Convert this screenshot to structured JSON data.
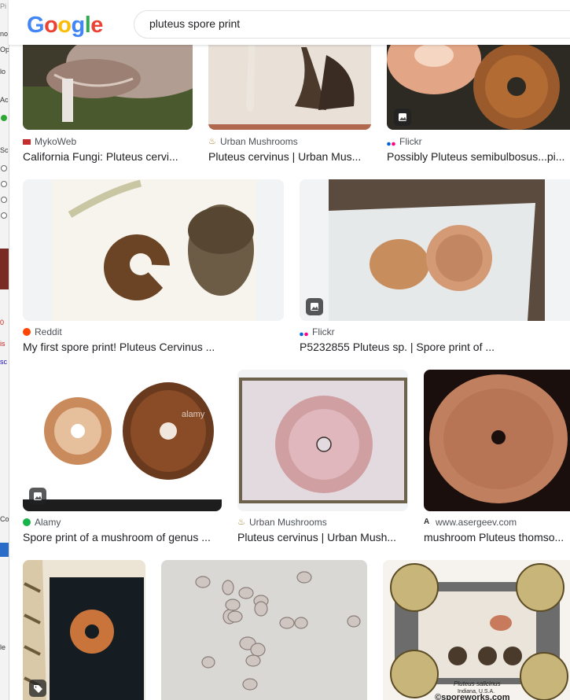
{
  "search": {
    "query": "pluteus spore print"
  },
  "logo": {
    "letters": [
      "G",
      "o",
      "o",
      "g",
      "l",
      "e"
    ],
    "colors": [
      "#4285F4",
      "#EA4335",
      "#FBBC05",
      "#4285F4",
      "#34A853",
      "#EA4335"
    ]
  },
  "left_strip": [
    "Pi",
    "no",
    "Op",
    "lo",
    "Ac",
    "Sc",
    "0",
    "is",
    "sc",
    "Co",
    "le"
  ],
  "results": [
    {
      "source": "MykoWeb",
      "title": "California Fungi: Pluteus cervi...",
      "icon": "mykoweb-favicon-icon",
      "badge": ""
    },
    {
      "source": "Urban Mushrooms",
      "title": "Pluteus cervinus | Urban Mus...",
      "icon": "urban-mushrooms-favicon-icon",
      "badge": ""
    },
    {
      "source": "Flickr",
      "title": "Possibly Pluteus semibulbosus...pi...",
      "icon": "flickr-favicon-icon",
      "badge": "image-icon"
    },
    {
      "source": "Reddit",
      "title": "My first spore print! Pluteus Cervinus ...",
      "icon": "reddit-favicon-icon",
      "badge": ""
    },
    {
      "source": "Flickr",
      "title": "P5232855 Pluteus sp. | Spore print of ...",
      "icon": "flickr-favicon-icon",
      "badge": "image-icon"
    },
    {
      "source": "Alamy",
      "title": "Spore print of a mushroom of genus ...",
      "icon": "alamy-favicon-icon",
      "badge": "image-icon"
    },
    {
      "source": "Urban Mushrooms",
      "title": "Pluteus cervinus | Urban Mush...",
      "icon": "urban-mushrooms-favicon-icon",
      "badge": ""
    },
    {
      "source": "www.asergeev.com",
      "title": "mushroom Pluteus thomso...",
      "icon": "asergeev-favicon-icon",
      "badge": ""
    },
    {
      "source": "",
      "title": "",
      "icon": "",
      "badge": "tag-icon"
    },
    {
      "source": "",
      "title": "",
      "icon": "",
      "badge": ""
    },
    {
      "source": "",
      "title": "",
      "icon": "",
      "badge": ""
    }
  ],
  "thumb_text": {
    "alamy_watermark": "alamy",
    "sporeworks_caption_1": "Pluteus salicinus",
    "sporeworks_caption_2": "Indiana, U.S.A.",
    "sporeworks_mark": "©sporeworks.com"
  }
}
